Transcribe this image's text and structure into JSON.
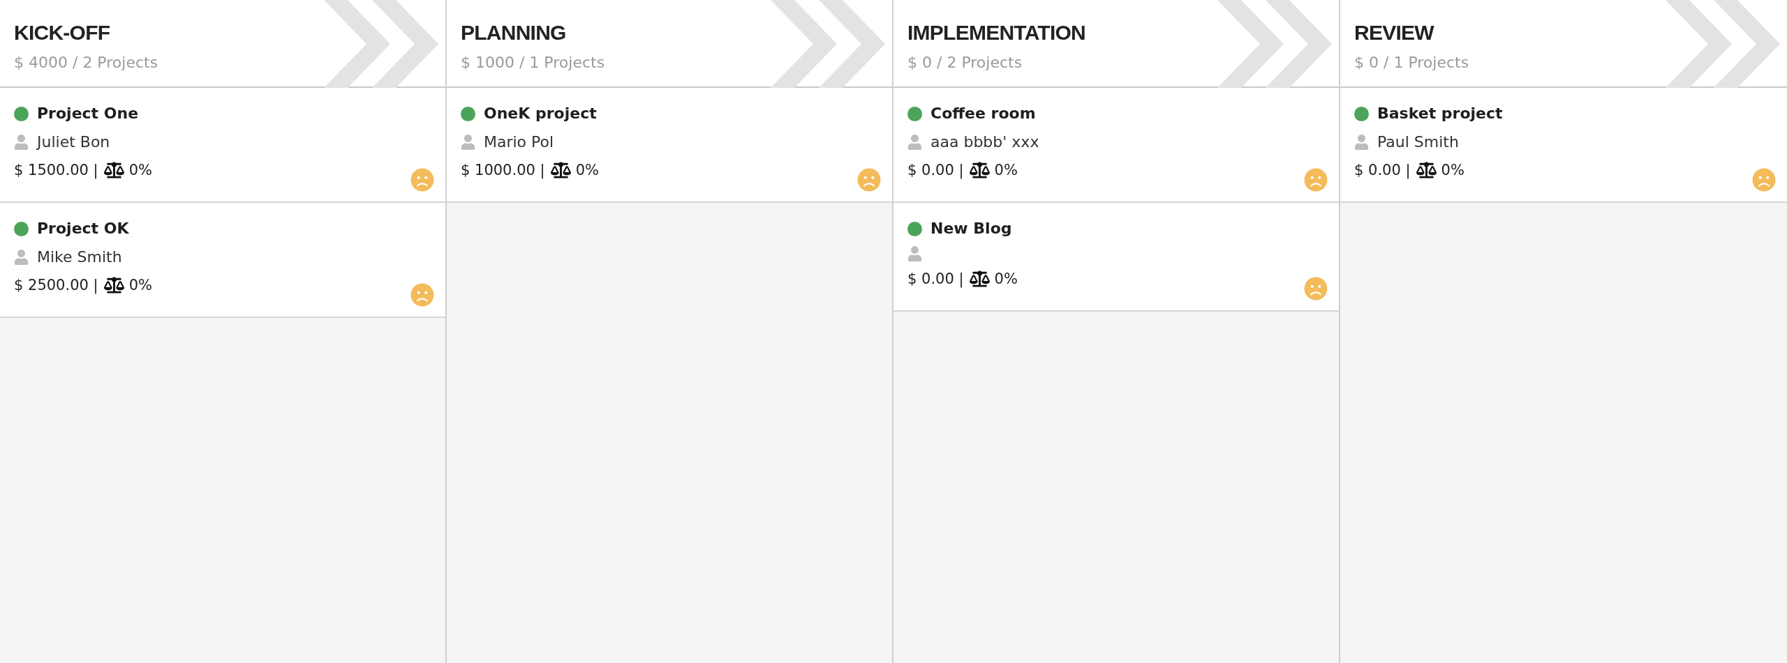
{
  "columns": [
    {
      "title": "KICK-OFF",
      "summary": "$ 4000 / 2 Projects",
      "projects": [
        {
          "name": "Project One",
          "color": "#4ca35a",
          "owner": "Juliet Bon",
          "amount": "$ 1500.00 |",
          "progress": "0%",
          "happy": false
        },
        {
          "name": "Project OK",
          "color": "#4ca35a",
          "owner": "Mike Smith",
          "amount": "$ 2500.00 |",
          "progress": "0%",
          "happy": false
        }
      ]
    },
    {
      "title": "PLANNING",
      "summary": "$ 1000 / 1 Projects",
      "projects": [
        {
          "name": "OneK project",
          "color": "#4ca35a",
          "owner": "Mario Pol",
          "amount": "$ 1000.00 |",
          "progress": "0%",
          "happy": false
        }
      ]
    },
    {
      "title": "IMPLEMENTATION",
      "summary": "$ 0 / 2 Projects",
      "projects": [
        {
          "name": "Coffee room",
          "color": "#4ca35a",
          "owner": "aaa bbbb' xxx",
          "amount": "$ 0.00 |",
          "progress": "0%",
          "happy": false
        },
        {
          "name": "New Blog",
          "color": "#4ca35a",
          "amount": "$ 0.00 |",
          "progress": "0%",
          "happy": false
        }
      ]
    },
    {
      "title": "REVIEW",
      "summary": "$ 0 / 1 Projects",
      "projects": [
        {
          "name": "Basket project",
          "color": "#4ca35a",
          "owner": "Paul Smith",
          "amount": "$ 0.00 |",
          "progress": "0%",
          "happy": false
        }
      ]
    }
  ]
}
